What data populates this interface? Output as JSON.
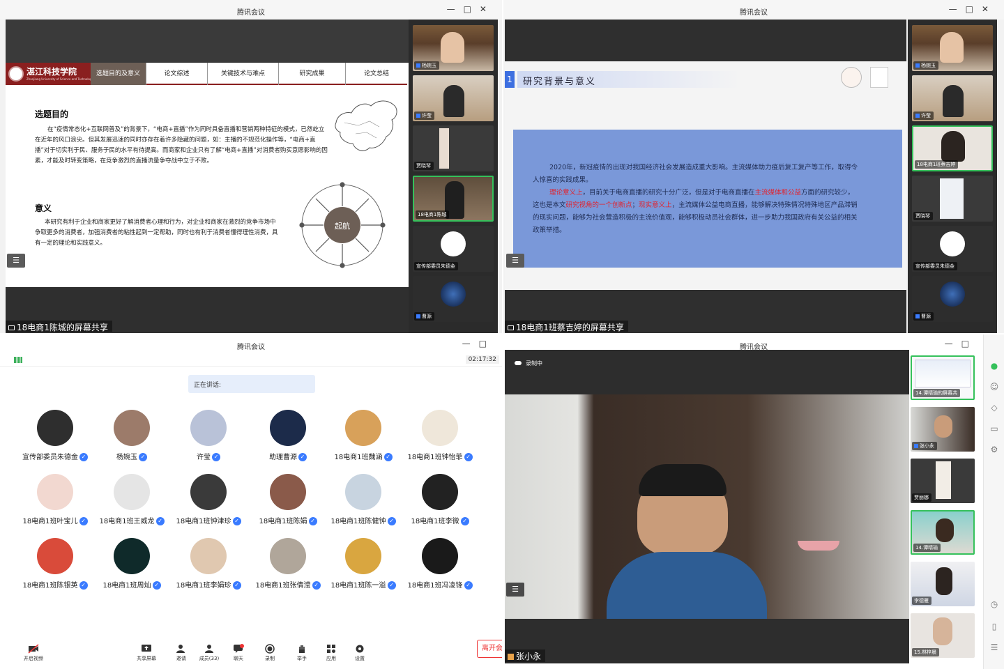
{
  "window_title": "腾讯会议",
  "q1": {
    "slide": {
      "school_name": "湛江科技学院",
      "school_sub": "Zhanjiang University of Science and Technology",
      "tabs": [
        "选题目的及意义",
        "论文综述",
        "关键技术与难点",
        "研究成果",
        "论文总结"
      ],
      "section1_title": "选题目的",
      "section1_text": "在“疫情常态化+互联网普及”的背景下，“电商+直播”作为同时具备直播和营销两种特征的模式，已然屹立在近年的风口浪尖。但其发展迅速的同时亦存在着许多隐藏的问题，如：主播的不规范化操作等，“电商+直播”对于切实利于民、服务于民的水平有待提高。而商家和企业只有了解“电商+直播”对消费者购买意愿影响的因素，才能及时转变策略，在竞争激烈的直播流量争夺战中立于不败。",
      "section2_title": "意义",
      "section2_text": "本研究有利于企业和商家更好了解消费者心理和行为，对企业和商家在激烈的竞争市场中争取更多的消费者，加强消费者的粘性起到一定帮助，同时也有利于消费者懂得理性消费，具有一定的理论和实践意义。",
      "diagram_center": "起航"
    },
    "share_label": "18电商1陈城的屏幕共享",
    "thumbs": [
      "杨婉玉",
      "许莹",
      "贾晓琴",
      "18电商1陈城",
      "宣传部委员朱德金",
      "曹源"
    ]
  },
  "q2": {
    "slide": {
      "number": "1",
      "title": "研究背景与意义",
      "p1": "2020年，新冠疫情的出现对我国经济社会发展造成重大影响。主流媒体助力疫后复工复产等工作，取得令人惊喜的实践成果。",
      "p2a": "理论意义上",
      "p2b": "，目前关于电商直播的研究十分广泛，但是对于电商直播在",
      "p2c": "主流媒体和公益",
      "p2d": "方面的研究较少，这也是本文",
      "p2e": "研究视角的一个创新点",
      "p2f": "；",
      "p2g": "现实意义上",
      "p2h": "，主流媒体公益电商直播，能够解决特殊情况特殊地区产品滞销的现实问题，能够为社会营造积极的主流价值观，能够积极动员社会群体，进一步助力我国政府有关公益的相关政策举措。"
    },
    "share_label": "18电商1班蔡吉婷的屏幕共享",
    "thumbs": [
      "杨婉玉",
      "许莹",
      "18电商1班蔡吉婷",
      "贾晓琴",
      "宣传部委员朱德金",
      "曹源"
    ]
  },
  "q3": {
    "timer": "02:17:32",
    "speaking_label": "正在讲话:",
    "participants": [
      "宣传部委员朱德金",
      "杨婉玉",
      "许莹",
      "助理曹源",
      "18电商1班魏涵",
      "18电商1班钟怡菲",
      "18电商1班叶宝儿",
      "18电商1班王威龙",
      "18电商1班钟津珍",
      "18电商1班陈娟",
      "18电商1班陈健钟",
      "18电商1班李微",
      "18电商1班陈银英",
      "18电商1班周灿",
      "18电商1班李娟珍",
      "18电商1班张倩滢",
      "18电商1班陈一溢",
      "18电商1班冯凌锋"
    ],
    "toolbar": {
      "video": "开启视频",
      "share": "共享屏幕",
      "invite": "邀请",
      "members": "成员(33)",
      "chat": "聊天",
      "record": "录制",
      "hand": "举手",
      "apps": "应用",
      "settings": "设置",
      "leave": "离开会"
    }
  },
  "q4": {
    "recording_label": "录制中",
    "speaker_name": "张小永",
    "thumbs": [
      "14.谭晴瑜的屏幕共",
      "张小永",
      "贾丽娜",
      "14.谭晴瑜",
      "李德雁",
      "15.林梓晨"
    ]
  }
}
